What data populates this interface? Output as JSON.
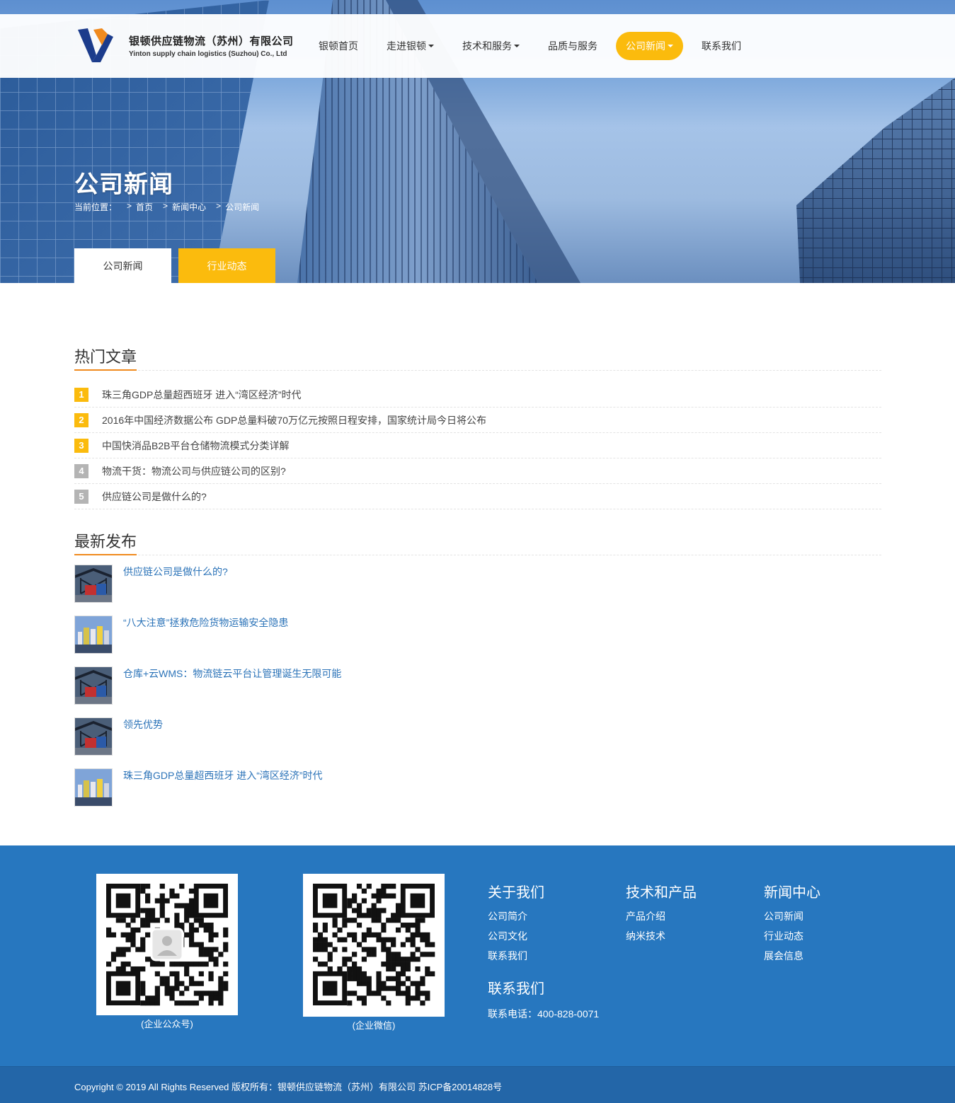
{
  "header": {
    "company_cn": "银顿供应链物流（苏州）有限公司",
    "company_en": "Yinton supply chain logistics (Suzhou) Co., Ltd",
    "nav": [
      {
        "label": "银顿首页",
        "dropdown": false,
        "active": false
      },
      {
        "label": "走进银顿",
        "dropdown": true,
        "active": false
      },
      {
        "label": "技术和服务",
        "dropdown": true,
        "active": false
      },
      {
        "label": "品质与服务",
        "dropdown": false,
        "active": false
      },
      {
        "label": "公司新闻",
        "dropdown": true,
        "active": true
      },
      {
        "label": "联系我们",
        "dropdown": false,
        "active": false
      }
    ]
  },
  "banner": {
    "title": "公司新闻",
    "breadcrumb": {
      "prefix": "当前位置：",
      "items": [
        "首页",
        "新闻中心",
        "公司新闻"
      ],
      "separator": ">"
    },
    "tabs": [
      {
        "label": "公司新闻",
        "active": true
      },
      {
        "label": "行业动态",
        "active": false
      }
    ]
  },
  "hot": {
    "title": "热门文章",
    "items": [
      {
        "num": "1",
        "text": "珠三角GDP总量超西班牙 进入“湾区经济”时代"
      },
      {
        "num": "2",
        "text": "2016年中国经济数据公布 GDP总量料破70万亿元按照日程安排，国家统计局今日将公布"
      },
      {
        "num": "3",
        "text": "中国快消品B2B平台仓储物流模式分类详解"
      },
      {
        "num": "4",
        "text": "物流干货：物流公司与供应链公司的区别?"
      },
      {
        "num": "5",
        "text": "供应链公司是做什么的?"
      }
    ]
  },
  "latest": {
    "title": "最新发布",
    "items": [
      {
        "text": "供应链公司是做什么的?",
        "thumb": "truck-bridge"
      },
      {
        "text": "“八大注意”拯救危险货物运输安全隐患",
        "thumb": "containers-city"
      },
      {
        "text": "仓库+云WMS：物流链云平台让管理诞生无限可能",
        "thumb": "truck-bridge"
      },
      {
        "text": "领先优势",
        "thumb": "truck-bridge"
      },
      {
        "text": "珠三角GDP总量超西班牙 进入“湾区经济”时代",
        "thumb": "containers-city"
      }
    ]
  },
  "footer": {
    "qr1_caption": "(企业公众号)",
    "qr2_caption": "(企业微信)",
    "about": {
      "title": "关于我们",
      "links": [
        "公司简介",
        "公司文化",
        "联系我们"
      ]
    },
    "tech": {
      "title": "技术和产品",
      "links": [
        "产品介绍",
        "纳米技术"
      ]
    },
    "news": {
      "title": "新闻中心",
      "links": [
        "公司新闻",
        "行业动态",
        "展会信息"
      ]
    },
    "contact": {
      "title": "联系我们",
      "tel": "联系电话：400-828-0071"
    },
    "copyright": "Copyright © 2019 All Rights Reserved 版权所有：银顿供应链物流（苏州）有限公司 苏ICP备20014828号"
  },
  "colors": {
    "accent": "#fbbb0d",
    "underline": "#f08a1d",
    "footer": "#2777bf",
    "link": "#2b73b8"
  }
}
